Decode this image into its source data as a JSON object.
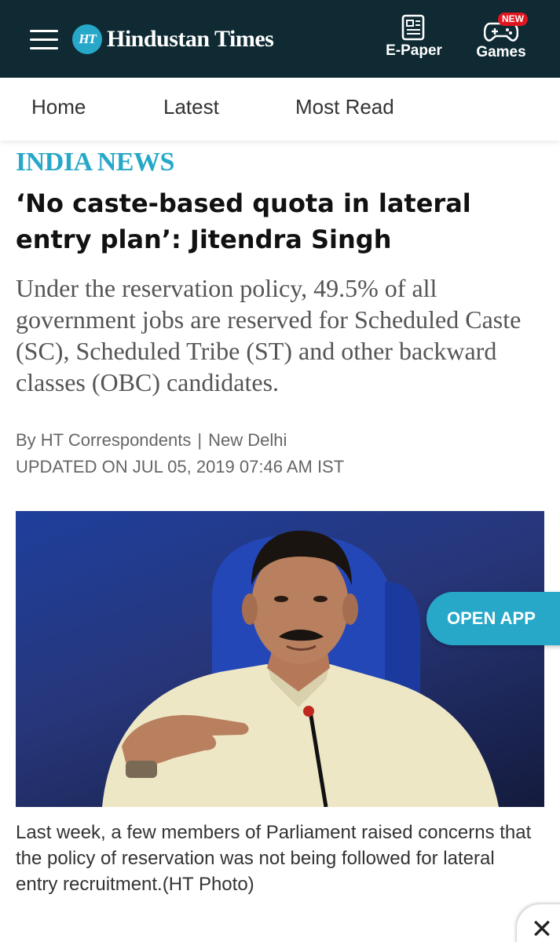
{
  "header": {
    "menu_icon": "hamburger-menu-icon",
    "logo_badge": "HT",
    "logo_text": "Hindustan Times",
    "epaper_label": "E-Paper",
    "epaper_icon": "newspaper-icon",
    "games_label": "Games",
    "games_icon": "gamepad-icon",
    "games_badge": "NEW",
    "bg_color": "#0f2a33"
  },
  "nav": {
    "items": [
      {
        "label": "Home"
      },
      {
        "label": "Latest"
      },
      {
        "label": "Most Read"
      }
    ]
  },
  "article": {
    "section": "INDIA NEWS",
    "section_color": "#27a8c9",
    "headline": "‘No caste-based quota in lateral entry plan’: Jitendra Singh",
    "summary": "Under the reservation policy, 49.5% of all government jobs are reserved for Scheduled Caste (SC), Scheduled Tribe (ST) and other backward classes (OBC) candidates.",
    "byline_author": "By HT Correspondents",
    "byline_separator": "|",
    "byline_location": "New Delhi",
    "updated": "UPDATED ON JUL 05, 2019 07:46 AM IST",
    "image_caption": "Last week, a few members of Parliament raised concerns that the policy of reservation was not being followed for lateral entry recruitment.(HT Photo)"
  },
  "overlays": {
    "open_app_label": "OPEN APP",
    "close_symbol": "✕",
    "close_icon": "close-icon"
  }
}
